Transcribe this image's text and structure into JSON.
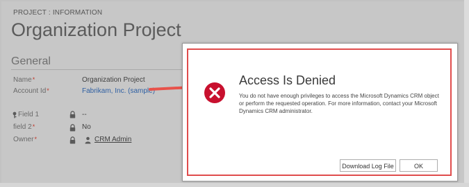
{
  "form": {
    "entity_type": "PROJECT : INFORMATION",
    "title": "Organization Project",
    "section": "General",
    "required_marker": "*",
    "fields": [
      {
        "label": "Name",
        "value": "Organization Project"
      },
      {
        "label": "Account Id",
        "value": "Fabrikam, Inc. (sample)"
      },
      {
        "label": "Field 1",
        "value": "--"
      },
      {
        "label": "field 2",
        "value": "No"
      },
      {
        "label": "Owner",
        "value": "CRM Admin"
      }
    ]
  },
  "dialog": {
    "title": "Access Is Denied",
    "message": "You do not have enough privileges to access the Microsoft Dynamics CRM object or perform the requested operation. For more information, contact your Microsoft Dynamics CRM administrator.",
    "download_button": "Download Log File",
    "ok_button": "OK"
  },
  "colors": {
    "highlight": "#e04c4c",
    "arrow": "#e8524a",
    "error_icon": "#c8102e",
    "link": "#2e5fa2"
  },
  "icons": [
    "lock-icon",
    "key-icon",
    "user-icon",
    "error-x-icon"
  ]
}
